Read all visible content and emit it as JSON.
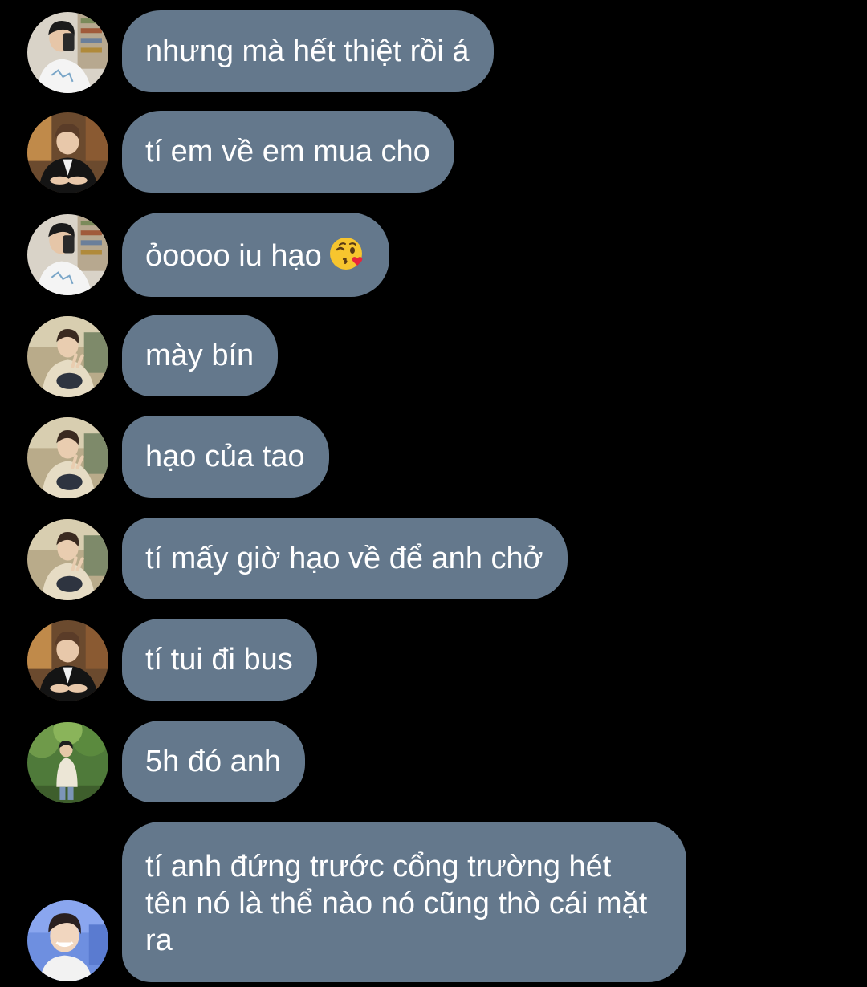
{
  "theme": {
    "background": "#000000",
    "bubble_color": "#64788c",
    "text_color": "#ffffff"
  },
  "messages": [
    {
      "avatar": "avatar-mirror-selfie-white-tee",
      "text": "nhưng mà hết thiệt rồi á"
    },
    {
      "avatar": "avatar-black-blazer-cafe",
      "text": "tí em về em mua cho"
    },
    {
      "avatar": "avatar-mirror-selfie-white-tee",
      "text": "ỏoooo iu hạo",
      "emoji": "face-blowing-kiss-emoji"
    },
    {
      "avatar": "avatar-cafe-peace-sign",
      "text": "mày bín"
    },
    {
      "avatar": "avatar-cafe-peace-sign",
      "text": "hạo của tao"
    },
    {
      "avatar": "avatar-cafe-peace-sign",
      "text": "tí mấy giờ hạo về để anh chở"
    },
    {
      "avatar": "avatar-black-blazer-cafe",
      "text": "tí tui đi bus"
    },
    {
      "avatar": "avatar-park-trees",
      "text": "5h đó anh"
    },
    {
      "avatar": "avatar-smiling-blue-background",
      "text": "tí anh đứng trước cổng trường hét tên nó là thể nào nó cũng thò cái mặt ra"
    }
  ]
}
